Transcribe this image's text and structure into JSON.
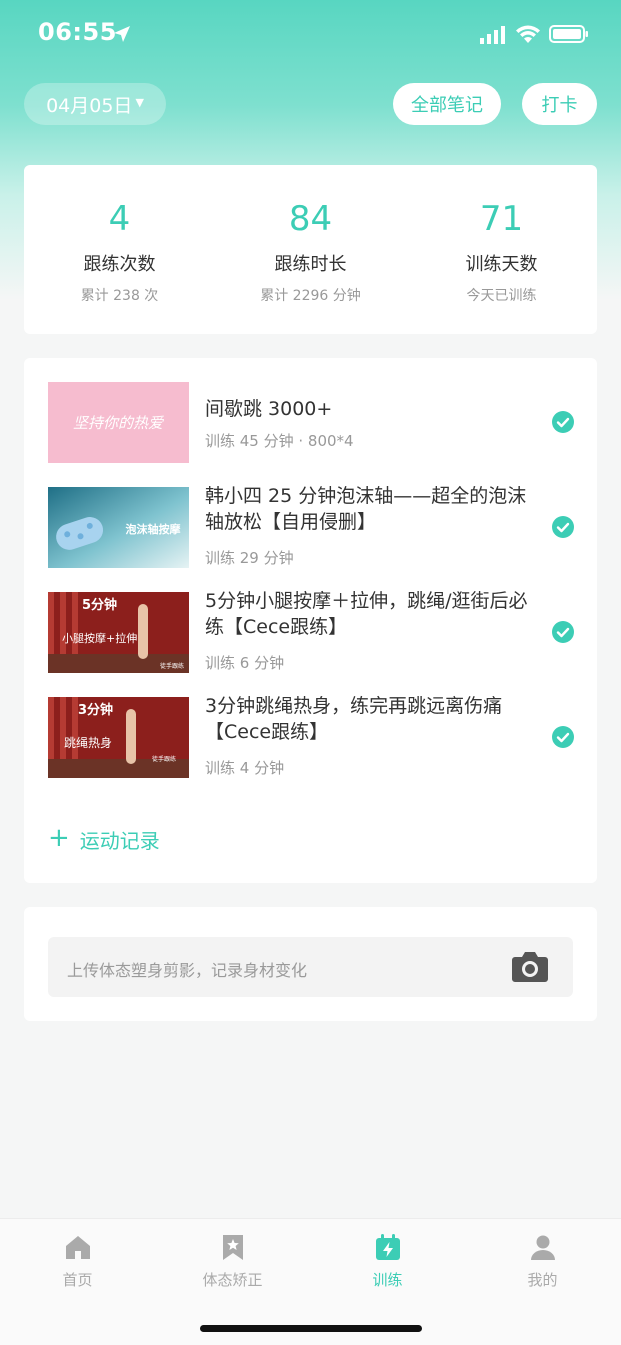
{
  "status_bar": {
    "time": "06:55"
  },
  "header": {
    "date_label": "04月05日",
    "all_notes_label": "全部笔记",
    "checkin_label": "打卡"
  },
  "stats": [
    {
      "value": "4",
      "label": "跟练次数",
      "sub": "累计 238 次"
    },
    {
      "value": "84",
      "label": "跟练时长",
      "sub": "累计 2296 分钟"
    },
    {
      "value": "71",
      "label": "训练天数",
      "sub": "今天已训练"
    }
  ],
  "workouts": [
    {
      "title": "间歇跳 3000+",
      "meta": "训练 45 分钟 · 800*4",
      "thumb_text": "坚持你的热爱",
      "completed": true
    },
    {
      "title": "韩小四 25 分钟泡沫轴——超全的泡沫轴放松【自用侵删】",
      "meta": "训练 29 分钟",
      "thumb_text": "泡沫轴按摩",
      "completed": true
    },
    {
      "title": "5分钟小腿按摩＋拉伸，跳绳/逛街后必练【Cece跟练】",
      "meta": "训练 6 分钟",
      "thumb_badge": "5分钟",
      "thumb_text": "小腿按摩+拉伸",
      "thumb_footer": "徒手跟练",
      "completed": true
    },
    {
      "title": "3分钟跳绳热身，练完再跳远离伤痛 【Cece跟练】",
      "meta": "训练 4 分钟",
      "thumb_badge": "3分钟",
      "thumb_text": "跳绳热身",
      "thumb_footer": "徒手跟练",
      "completed": true
    }
  ],
  "add_record_label": "运动记录",
  "upload": {
    "placeholder": "上传体态塑身剪影，记录身材变化"
  },
  "tabs": [
    {
      "label": "首页",
      "icon": "home-icon",
      "active": false
    },
    {
      "label": "体态矫正",
      "icon": "bookmark-star-icon",
      "active": false
    },
    {
      "label": "训练",
      "icon": "calendar-bolt-icon",
      "active": true
    },
    {
      "label": "我的",
      "icon": "person-icon",
      "active": false
    }
  ],
  "colors": {
    "accent": "#3ccdb5",
    "header_gradient_top": "#58d6c1"
  }
}
